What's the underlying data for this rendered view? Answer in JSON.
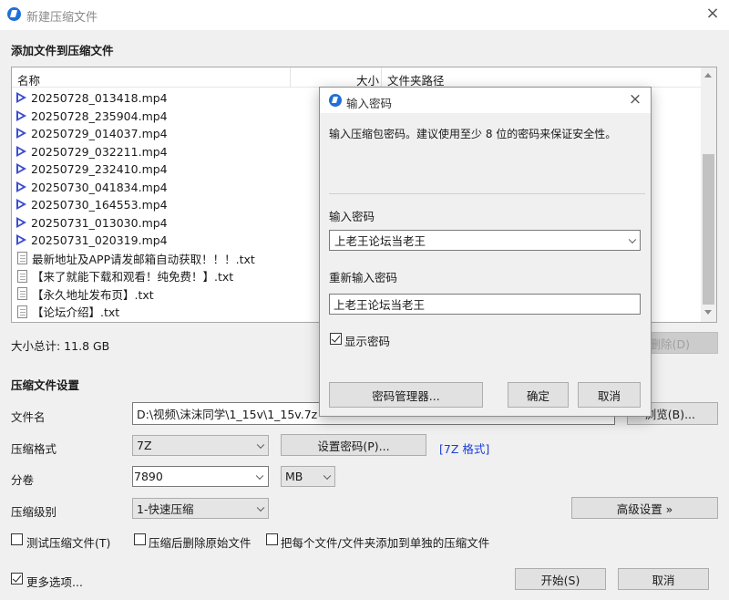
{
  "window": {
    "title": "新建压缩文件"
  },
  "add_section": {
    "title": "添加文件到压缩文件"
  },
  "file_list": {
    "columns": {
      "name": "名称",
      "size": "大小",
      "path": "文件夹路径"
    },
    "items": [
      {
        "name": "20250728_013418.mp4",
        "type": "video"
      },
      {
        "name": "20250728_235904.mp4",
        "type": "video"
      },
      {
        "name": "20250729_014037.mp4",
        "type": "video"
      },
      {
        "name": "20250729_032211.mp4",
        "type": "video"
      },
      {
        "name": "20250729_232410.mp4",
        "type": "video"
      },
      {
        "name": "20250730_041834.mp4",
        "type": "video"
      },
      {
        "name": "20250730_164553.mp4",
        "type": "video"
      },
      {
        "name": "20250731_013030.mp4",
        "type": "video"
      },
      {
        "name": "20250731_020319.mp4",
        "type": "video"
      },
      {
        "name": "最新地址及APP请发邮箱自动获取！！！.txt",
        "type": "text"
      },
      {
        "name": "【来了就能下载和观看！纯免费！】.txt",
        "type": "text"
      },
      {
        "name": "【永久地址发布页】.txt",
        "type": "text"
      },
      {
        "name": "【论坛介绍】.txt",
        "type": "text"
      }
    ]
  },
  "total_size": "大小总计: 11.8 GB",
  "delete_button": "删除(D)",
  "settings": {
    "title": "压缩文件设置",
    "filename_label": "文件名",
    "filename_value": "D:\\视频\\沫沫同学\\1_15v\\1_15v.7z",
    "browse_button": "浏览(B)...",
    "format_label": "压缩格式",
    "format_value": "7Z",
    "set_password_button": "设置密码(P)...",
    "format_link": "[7Z 格式]",
    "volume_label": "分卷",
    "volume_value": "7890",
    "volume_unit": "MB",
    "level_label": "压缩级别",
    "level_value": "1-快速压缩",
    "advanced_button": "高级设置 »",
    "test_checkbox": "测试压缩文件(T)",
    "delete_after_checkbox": "压缩后删除原始文件",
    "separate_checkbox": "把每个文件/文件夹添加到单独的压缩文件",
    "more_options_checkbox": "更多选项...",
    "start_button": "开始(S)",
    "cancel_button": "取消"
  },
  "password_dialog": {
    "title": "输入密码",
    "description": "输入压缩包密码。建议使用至少 8 位的密码来保证安全性。",
    "password_label": "输入密码",
    "password_value": "上老王论坛当老王",
    "confirm_label": "重新输入密码",
    "confirm_value": "上老王论坛当老王",
    "show_password": "显示密码",
    "manager_button": "密码管理器...",
    "ok_button": "确定",
    "cancel_button": "取消"
  },
  "colors": {
    "accent": "#1e6fd9",
    "link": "#1b3fd6",
    "video_icon": "#3b4ed0"
  }
}
